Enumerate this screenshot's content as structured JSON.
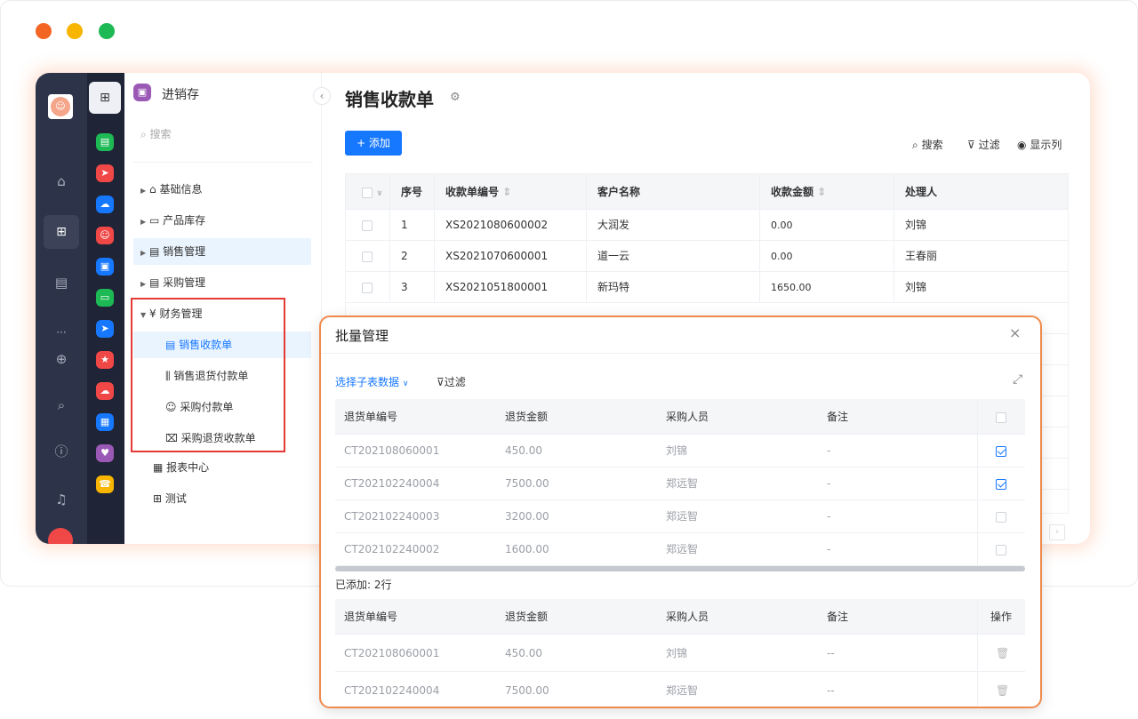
{
  "window": {
    "dots": [
      "#f26522",
      "#f7b500",
      "#1db954"
    ]
  },
  "rail": {
    "icons": [
      "apps-grid-icon",
      "home-icon",
      "grid-icon",
      "document-icon",
      "more-icon",
      "add-circle-icon",
      "search-icon",
      "help-icon",
      "bell-icon"
    ]
  },
  "app_icons": [
    {
      "color": "#1db954",
      "name": "doc-app-icon"
    },
    {
      "color": "#f04747",
      "name": "send-app-icon"
    },
    {
      "color": "#1677ff",
      "name": "chat-app-icon"
    },
    {
      "color": "#f04747",
      "name": "user-app-icon"
    },
    {
      "color": "#1677ff",
      "name": "truck-app-icon"
    },
    {
      "color": "#1db954",
      "name": "ticket-app-icon"
    },
    {
      "color": "#1677ff",
      "name": "plane-app-icon"
    },
    {
      "color": "#f04747",
      "name": "star-app-icon"
    },
    {
      "color": "#f04747",
      "name": "bubble-app-icon"
    },
    {
      "color": "#1677ff",
      "name": "print-app-icon"
    },
    {
      "color": "#9b59b6",
      "name": "heart-app-icon"
    },
    {
      "color": "#f7b500",
      "name": "phone-app-icon"
    }
  ],
  "nav": {
    "app_title": "进销存",
    "search_placeholder": "搜索",
    "items": [
      {
        "label": "基础信息",
        "icon": "⌂"
      },
      {
        "label": "产品库存",
        "icon": "▭"
      },
      {
        "label": "销售管理",
        "icon": "▤"
      },
      {
        "label": "采购管理",
        "icon": "▤"
      },
      {
        "label": "财务管理",
        "icon": "¥"
      }
    ],
    "finance_sub": [
      {
        "label": "销售收款单",
        "icon": "▤"
      },
      {
        "label": "销售退货付款单",
        "icon": "⫼"
      },
      {
        "label": "采购付款单",
        "icon": "☺"
      },
      {
        "label": "采购退货收款单",
        "icon": "⌧"
      }
    ],
    "extra": [
      {
        "label": "报表中心",
        "icon": "▦"
      },
      {
        "label": "测试",
        "icon": "⊞"
      }
    ]
  },
  "main": {
    "title": "销售收款单",
    "add_label": "+ 添加",
    "toolbar": {
      "search": "搜索",
      "filter": "过滤",
      "columns": "显示列"
    },
    "headers": [
      "序号",
      "收款单编号",
      "客户名称",
      "收款金额",
      "处理人"
    ],
    "rows": [
      {
        "no": "1",
        "code": "XS2021080600002",
        "customer": "大润发",
        "amount": "0.00",
        "handler": "刘锦"
      },
      {
        "no": "2",
        "code": "XS2021070600001",
        "customer": "道一云",
        "amount": "0.00",
        "handler": "王春丽"
      },
      {
        "no": "3",
        "code": "XS2021051800001",
        "customer": "新玛特",
        "amount": "1650.00",
        "handler": "刘锦"
      }
    ]
  },
  "modal": {
    "title": "批量管理",
    "select_label": "选择子表数据",
    "filter_label": "过滤",
    "headers": [
      "退货单编号",
      "退货金额",
      "采购人员",
      "备注"
    ],
    "rows": [
      {
        "code": "CT202108060001",
        "amount": "450.00",
        "buyer": "刘锦",
        "note": "-",
        "checked": true
      },
      {
        "code": "CT202102240004",
        "amount": "7500.00",
        "buyer": "郑远智",
        "note": "-",
        "checked": true
      },
      {
        "code": "CT202102240003",
        "amount": "3200.00",
        "buyer": "郑远智",
        "note": "-",
        "checked": false
      },
      {
        "code": "CT202102240002",
        "amount": "1600.00",
        "buyer": "郑远智",
        "note": "-",
        "checked": false
      }
    ],
    "added_label": "已添加: 2行",
    "added_headers": [
      "退货单编号",
      "退货金额",
      "采购人员",
      "备注",
      "操作"
    ],
    "added_rows": [
      {
        "code": "CT202108060001",
        "amount": "450.00",
        "buyer": "刘锦",
        "note": "--"
      },
      {
        "code": "CT202102240004",
        "amount": "7500.00",
        "buyer": "郑远智",
        "note": "--"
      }
    ]
  }
}
